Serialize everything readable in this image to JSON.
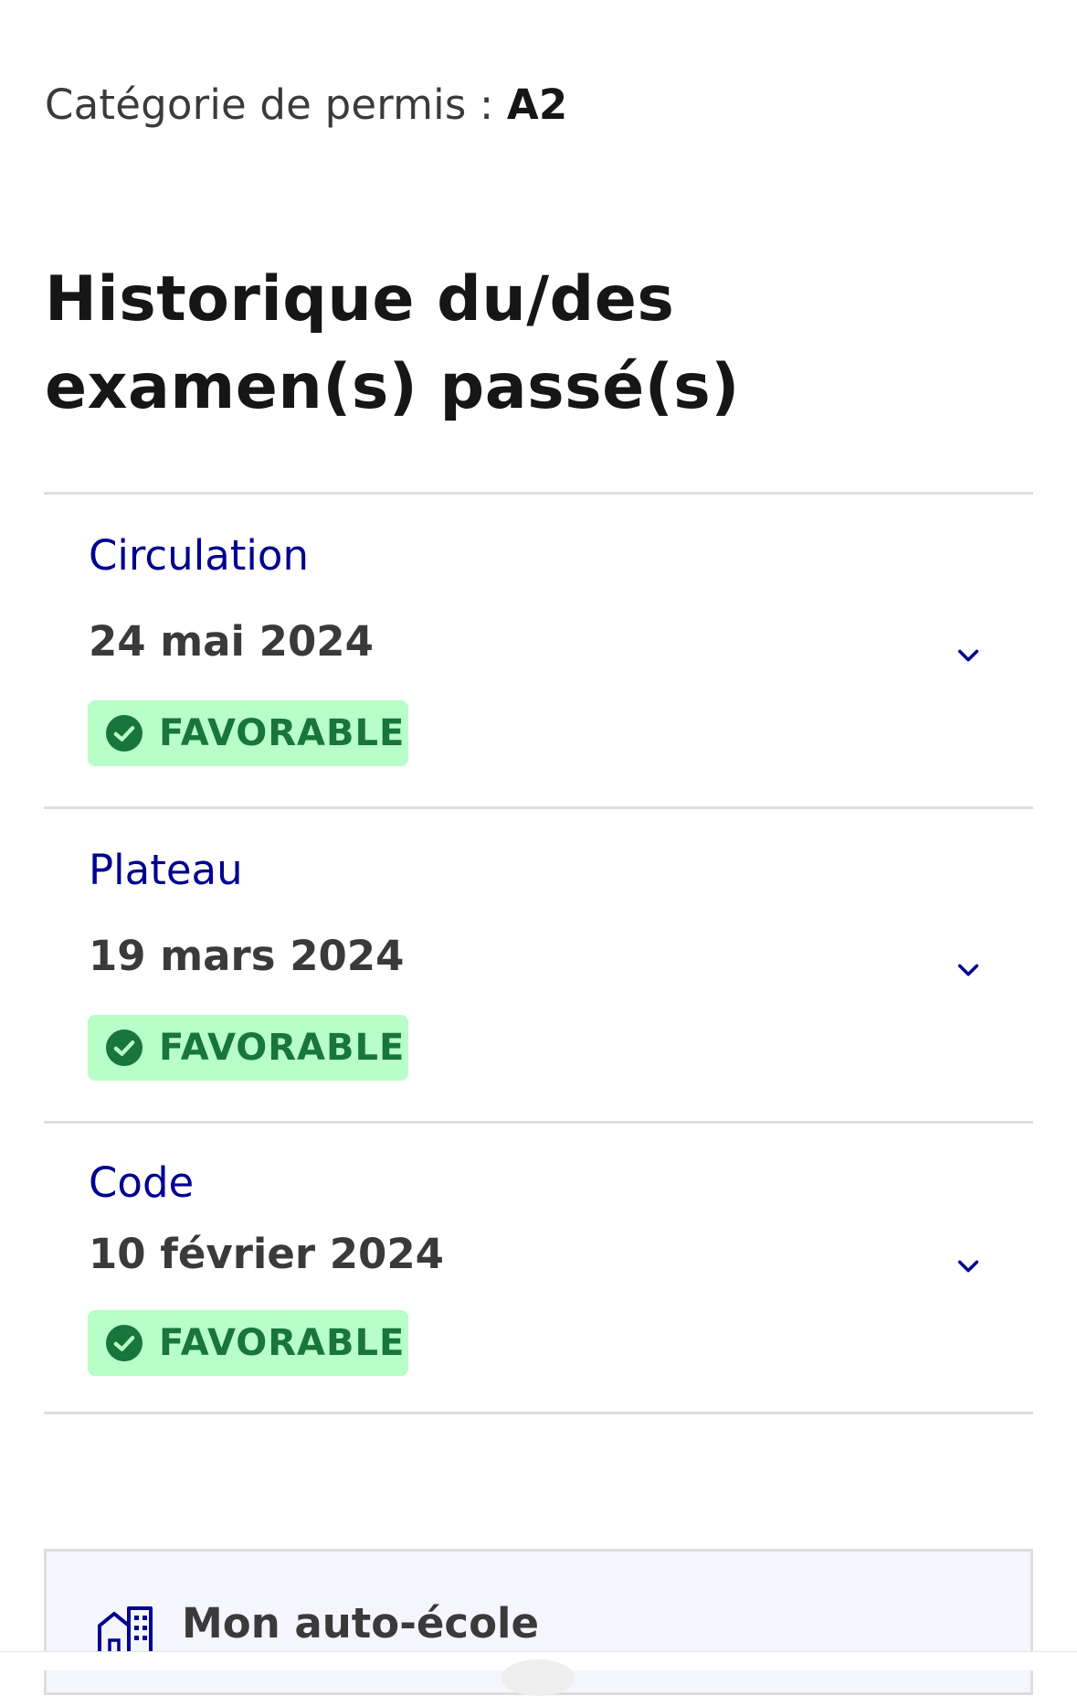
{
  "permit": {
    "label": "Catégorie de permis : ",
    "value": "A2"
  },
  "history_title": "Historique du/des examen(s) passé(s)",
  "exams": [
    {
      "type": "Circulation",
      "date": "24 mai 2024",
      "status": "FAVORABLE"
    },
    {
      "type": "Plateau",
      "date": "19 mars 2024",
      "status": "FAVORABLE"
    },
    {
      "type": "Code",
      "date": "10 février 2024",
      "status": "FAVORABLE"
    }
  ],
  "school_card": {
    "title": "Mon auto-école",
    "icon": "building-icon"
  },
  "icons": {
    "expand": "chevron-down-icon",
    "status": "check-circle-icon"
  },
  "colors": {
    "link_blue": "#000091",
    "success_bg": "#b8fec9",
    "success_text": "#18753c",
    "divider": "#dddddd",
    "card_bg": "#f5f5fe"
  }
}
